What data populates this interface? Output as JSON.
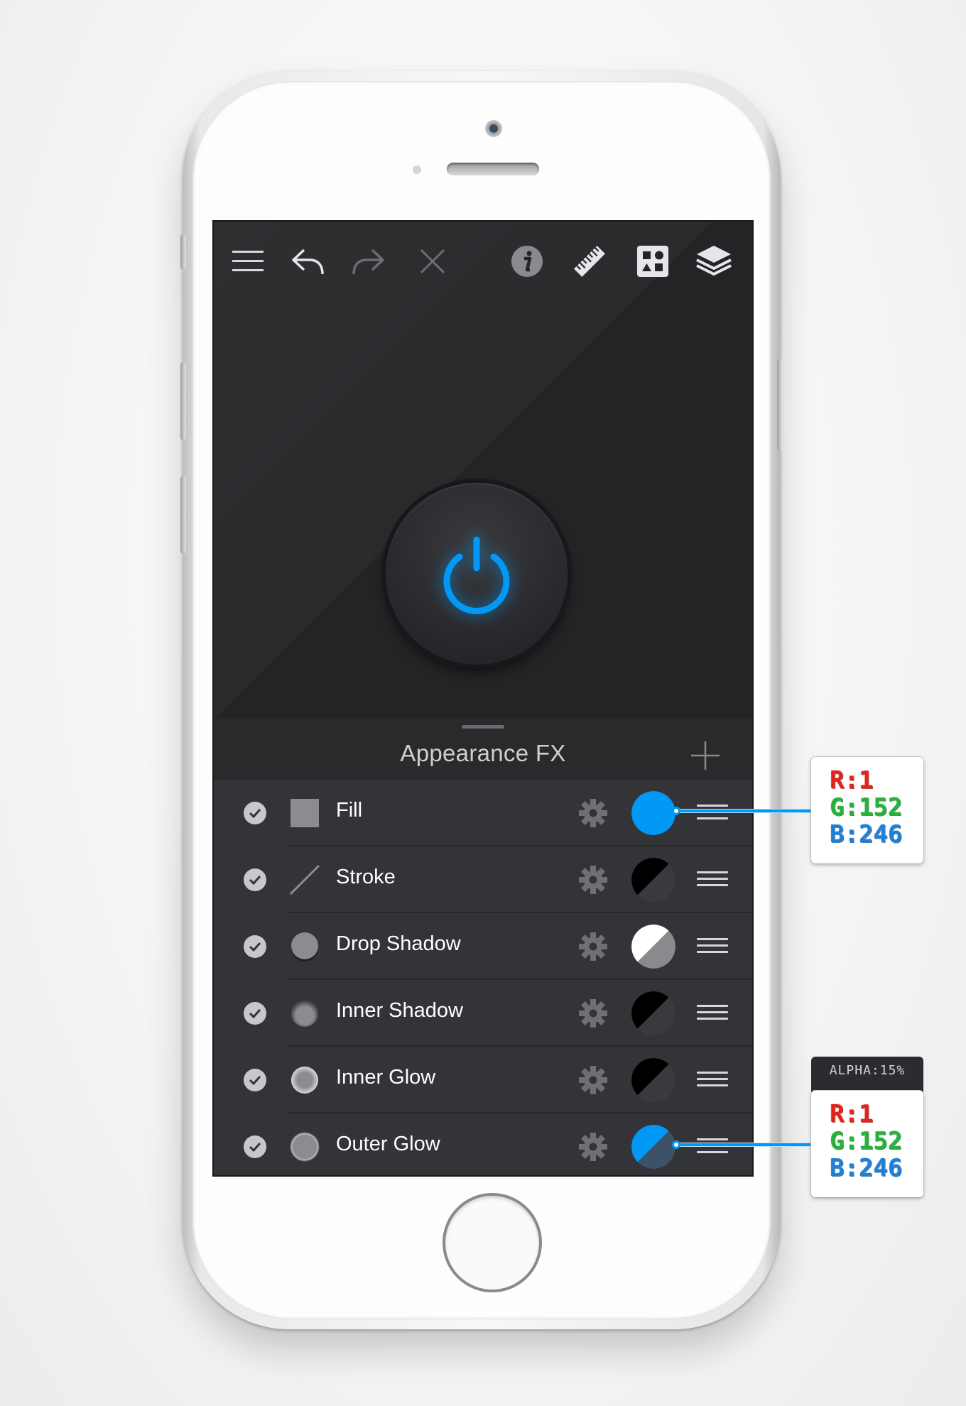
{
  "toolbar": {
    "buttons": [
      {
        "icon": "menu-icon"
      },
      {
        "icon": "undo-icon"
      },
      {
        "icon": "redo-icon"
      },
      {
        "icon": "close-icon"
      },
      {
        "icon": "info-icon"
      },
      {
        "icon": "ruler-icon"
      },
      {
        "icon": "shapes-icon"
      },
      {
        "icon": "layers-icon"
      }
    ]
  },
  "canvas": {
    "object": "power-button",
    "icon": "power-icon",
    "accent_color": "#0198f6"
  },
  "panel": {
    "title": "Appearance FX",
    "add_icon": "plus-icon"
  },
  "effects": [
    {
      "label": "Fill",
      "enabled": true,
      "preview": "square",
      "swatch": "solid-blue"
    },
    {
      "label": "Stroke",
      "enabled": true,
      "preview": "line",
      "swatch": "black-dark-split"
    },
    {
      "label": "Drop Shadow",
      "enabled": true,
      "preview": "circle",
      "swatch": "white-gray-split"
    },
    {
      "label": "Inner Shadow",
      "enabled": true,
      "preview": "circle-inner-shadow",
      "swatch": "black-dark-split"
    },
    {
      "label": "Inner Glow",
      "enabled": true,
      "preview": "circle-inner-glow",
      "swatch": "black-dark-split"
    },
    {
      "label": "Outer Glow",
      "enabled": true,
      "preview": "circle-outer-glow",
      "swatch": "blue-dark-split"
    }
  ],
  "callouts": {
    "fill": {
      "r": "R:1",
      "g": "G:152",
      "b": "B:246"
    },
    "outer_glow": {
      "alpha": "ALPHA:15%",
      "r": "R:1",
      "g": "G:152",
      "b": "B:246"
    }
  },
  "colors": {
    "blue": "#0198f6",
    "screen_bg": "#242427",
    "panel_bg": "#333438"
  }
}
